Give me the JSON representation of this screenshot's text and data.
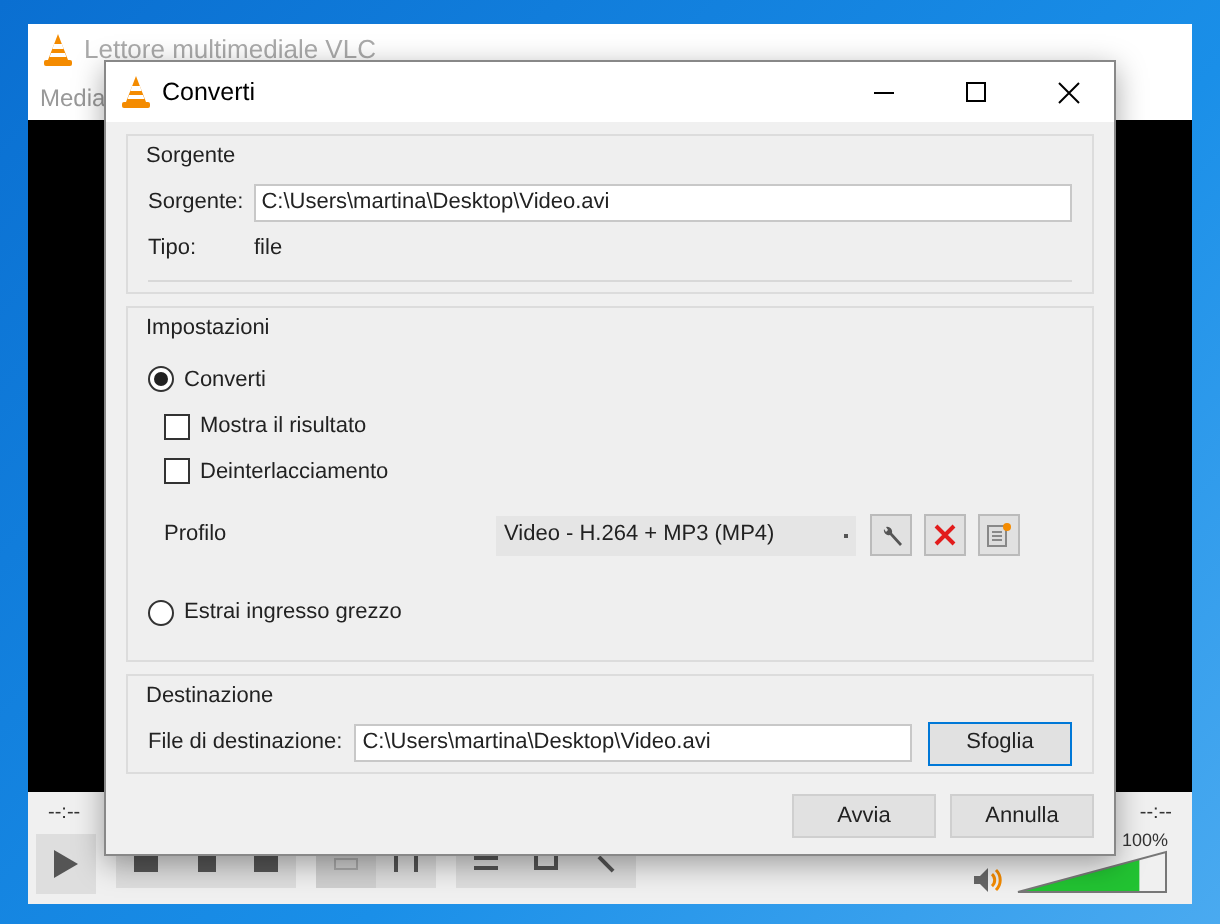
{
  "main_window": {
    "title": "Lettore multimediale VLC",
    "menu": [
      "Media"
    ],
    "time_elapsed": "--:--",
    "time_total": "--:--",
    "volume": {
      "reading": "100%",
      "level": 0.82
    }
  },
  "dialog": {
    "title": "Converti",
    "source": {
      "heading": "Sorgente",
      "label": "Sorgente:",
      "value": "C:\\Users\\martina\\Desktop\\Video.avi",
      "type_label": "Tipo:",
      "type_value": "file"
    },
    "settings": {
      "heading": "Impostazioni",
      "options": [
        {
          "kind": "radio",
          "label": "Converti",
          "selected": true
        },
        {
          "kind": "checkbox",
          "label": "Mostra il risultato",
          "checked": false
        },
        {
          "kind": "checkbox",
          "label": "Deinterlacciamento",
          "checked": false
        },
        {
          "kind": "profile",
          "label": "Profilo",
          "value": "Video - H.264 + MP3 (MP4)"
        },
        {
          "kind": "radio",
          "label": "Estrai ingresso grezzo",
          "selected": false
        }
      ]
    },
    "destination": {
      "heading": "Destinazione",
      "label": "File di destinazione:",
      "value": "C:\\Users\\martina\\Desktop\\Video.avi",
      "browse": "Sfoglia"
    },
    "buttons": [
      "Avvia",
      "Annulla"
    ]
  }
}
